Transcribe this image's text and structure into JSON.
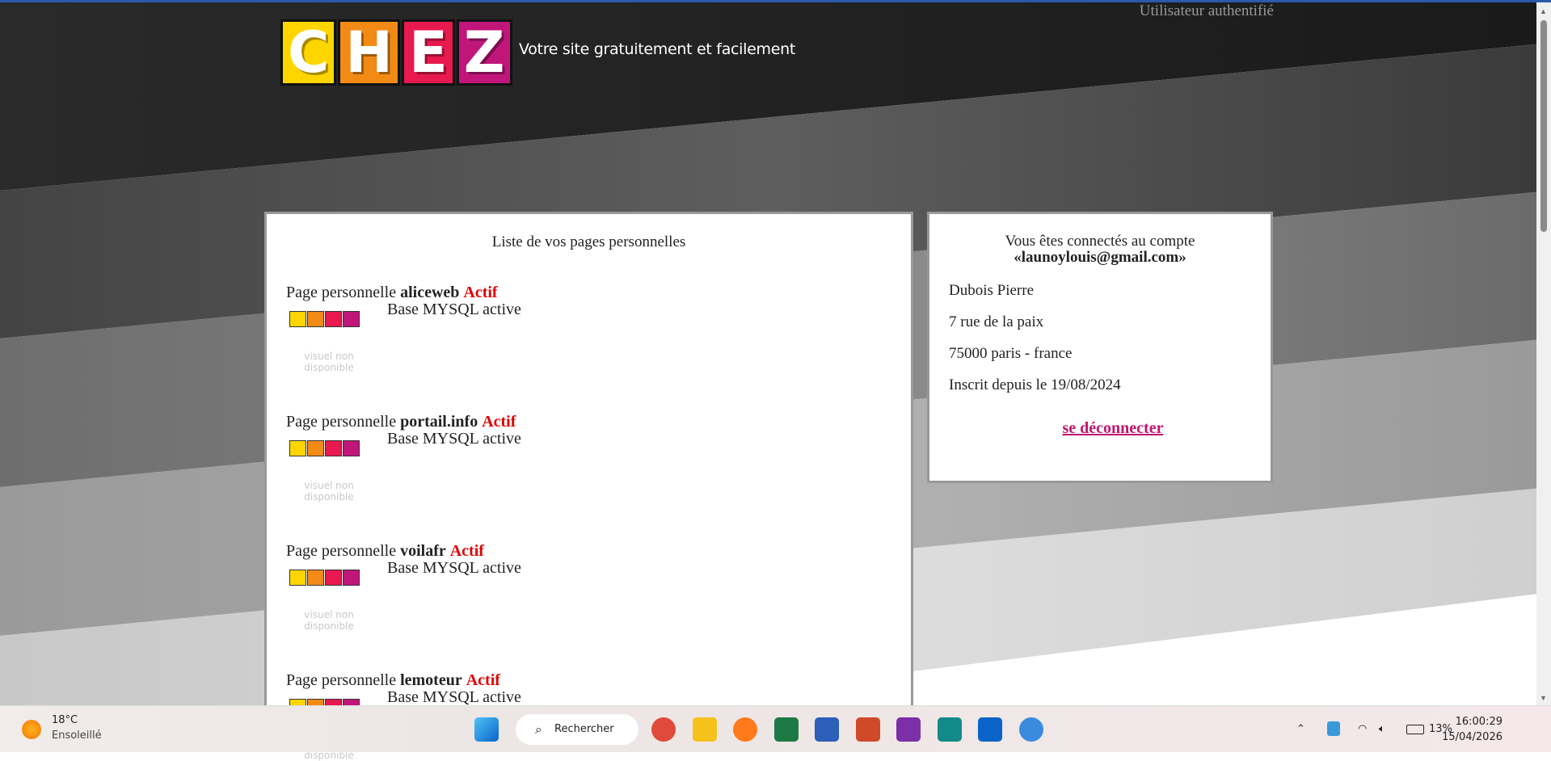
{
  "header": {
    "logo_letters": [
      "C",
      "H",
      "E",
      "Z"
    ],
    "tagline": "Votre site gratuitement et facilement",
    "user_status": "Utilisateur authentifié"
  },
  "pages_panel": {
    "title": "Liste de vos pages personnelles",
    "prefix": "Page personnelle",
    "entries": [
      {
        "name": "aliceweb",
        "status": "Actif",
        "db": "Base MYSQL active",
        "preview": "visuel non disponible"
      },
      {
        "name": "portail.info",
        "status": "Actif",
        "db": "Base MYSQL active",
        "preview": "visuel non disponible"
      },
      {
        "name": "voilafr",
        "status": "Actif",
        "db": "Base MYSQL active",
        "preview": "visuel non disponible"
      },
      {
        "name": "lemoteur",
        "status": "Actif",
        "db": "Base MYSQL active",
        "preview": "visuel non disponible"
      }
    ]
  },
  "account_panel": {
    "connected_label": "Vous êtes connectés au compte",
    "email": "«launoylouis@gmail.com»",
    "name": "Dubois Pierre",
    "address": "7 rue de la paix",
    "city": "75000 paris - france",
    "since": "Inscrit depuis le 19/08/2024",
    "logout": "se déconnecter"
  },
  "taskbar": {
    "temperature": "18°C",
    "weather": "Ensoleillé",
    "search": "Rechercher",
    "battery": "13%",
    "time": "16:00:29",
    "date": "15/04/2026",
    "apps": [
      {
        "name": "start",
        "color": "#1a8ce0"
      },
      {
        "name": "chrome",
        "color": "#e04a3a"
      },
      {
        "name": "file-explorer",
        "color": "#f5c21b"
      },
      {
        "name": "firefox",
        "color": "#ff7a1a"
      },
      {
        "name": "excel",
        "color": "#1d7a45"
      },
      {
        "name": "word",
        "color": "#2b5fb8"
      },
      {
        "name": "powerpoint",
        "color": "#d04a2a"
      },
      {
        "name": "onenote",
        "color": "#7b2fa8"
      },
      {
        "name": "publisher",
        "color": "#138a8a"
      },
      {
        "name": "outlook",
        "color": "#0a64c8"
      },
      {
        "name": "chrome-profile",
        "color": "#3a8ae0"
      }
    ]
  },
  "colors": {
    "accent_red": "#e00000",
    "link": "#c0166f",
    "logo": [
      "#ffd500",
      "#f28a16",
      "#e8194f",
      "#c0167a"
    ]
  }
}
